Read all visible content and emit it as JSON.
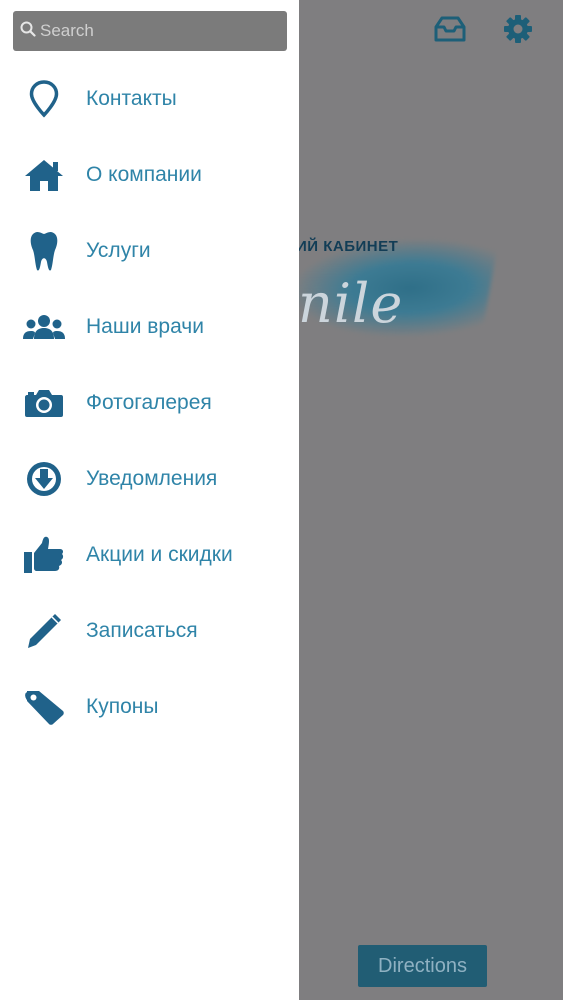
{
  "background": {
    "logo_subtitle": "ИЙ КАБИНЕТ",
    "logo_word": "nile",
    "directions_label": "Directions"
  },
  "search": {
    "placeholder": "Search"
  },
  "menu": {
    "items": [
      {
        "label": "Контакты",
        "icon": "location-pin-icon"
      },
      {
        "label": "О компании",
        "icon": "home-icon"
      },
      {
        "label": "Услуги",
        "icon": "tooth-icon"
      },
      {
        "label": "Наши врачи",
        "icon": "group-icon"
      },
      {
        "label": "Фотогалерея",
        "icon": "camera-icon"
      },
      {
        "label": "Уведомления",
        "icon": "download-circle-icon"
      },
      {
        "label": "Акции и скидки",
        "icon": "thumbs-up-icon"
      },
      {
        "label": "Записаться",
        "icon": "pencil-icon"
      },
      {
        "label": "Купоны",
        "icon": "tag-icon"
      }
    ]
  },
  "colors": {
    "accent": "#2f84a8",
    "icon": "#20628a",
    "overlay": "#7f7e80",
    "search_bg": "#7b7b7b",
    "directions_bg": "#215d74"
  }
}
